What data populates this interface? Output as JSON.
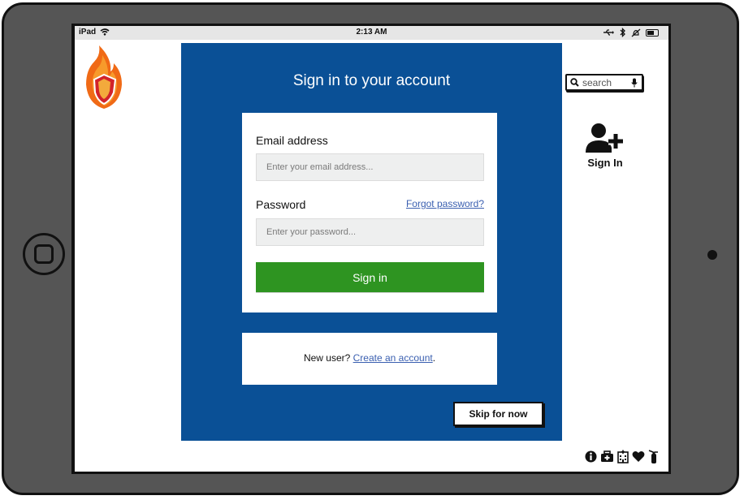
{
  "status_bar": {
    "device": "iPad",
    "time": "2:13 AM",
    "icons": [
      "wifi-icon",
      "usb-icon",
      "bluetooth-icon",
      "mute-icon",
      "battery-icon"
    ]
  },
  "logo": {
    "icon": "flame-shield-logo"
  },
  "signin_panel": {
    "title": "Sign in to your account",
    "email_label": "Email address",
    "email_placeholder": "Enter your email address...",
    "password_label": "Password",
    "forgot_link": "Forgot password?",
    "password_placeholder": "Enter your password...",
    "submit_label": "Sign in"
  },
  "register": {
    "prompt": "New user?",
    "link": "Create an account",
    "suffix": "."
  },
  "skip_label": "Skip for now",
  "search": {
    "placeholder": "search",
    "icons": [
      "search-icon",
      "microphone-icon"
    ]
  },
  "sign_in_shortcut": {
    "label": "Sign In",
    "icon": "add-user-icon"
  },
  "footer_icons": [
    "info-icon",
    "first-aid-icon",
    "hospital-icon",
    "heart-icon",
    "fire-extinguisher-icon"
  ],
  "colors": {
    "panel_bg": "#0a5096",
    "submit_button": "#2e9421",
    "link": "#3a5fb0",
    "device_body": "#555555"
  }
}
